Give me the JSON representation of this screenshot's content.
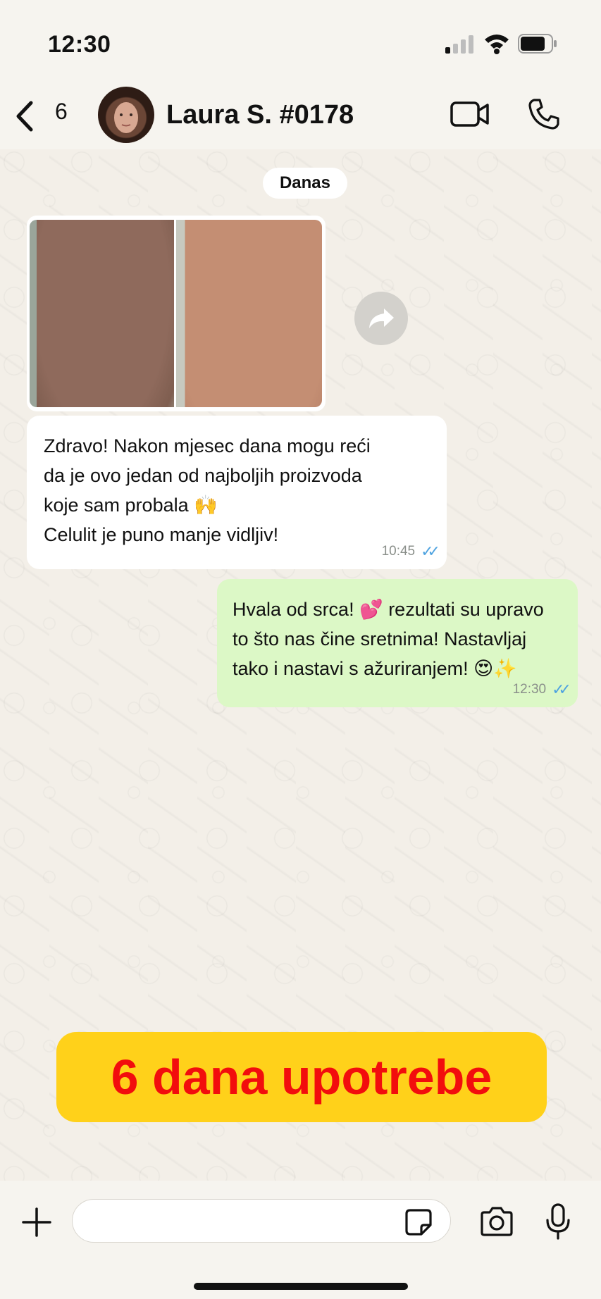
{
  "status_bar": {
    "time": "12:30"
  },
  "header": {
    "back_count": "6",
    "contact_name": "Laura S. #0178"
  },
  "chat": {
    "date_label": "Danas",
    "incoming": {
      "lines": [
        "Zdravo! Nakon mjesec dana mogu reći",
        "da je ovo jedan od najboljih proizvoda",
        "koje sam probala 🙌",
        "Celulit je puno manje vidljiv!"
      ],
      "time": "10:45",
      "ticks": "✓✓"
    },
    "outgoing": {
      "lines": [
        "Hvala od srca! 💕 rezultati su upravo",
        "to što nas čine sretnima! Nastavljaj",
        "tako i nastavi s ažuriranjem! 😍✨"
      ],
      "time": "12:30",
      "ticks": "✓✓"
    }
  },
  "banner": {
    "text": "6 dana upotrebe"
  },
  "input": {
    "placeholder": "",
    "value": ""
  },
  "colors": {
    "outgoing_bubble": "#dcf8c6",
    "incoming_bubble": "#ffffff",
    "banner_bg": "#ffd11a",
    "banner_text": "#f20d0d",
    "read_ticks": "#4fa3e0"
  }
}
